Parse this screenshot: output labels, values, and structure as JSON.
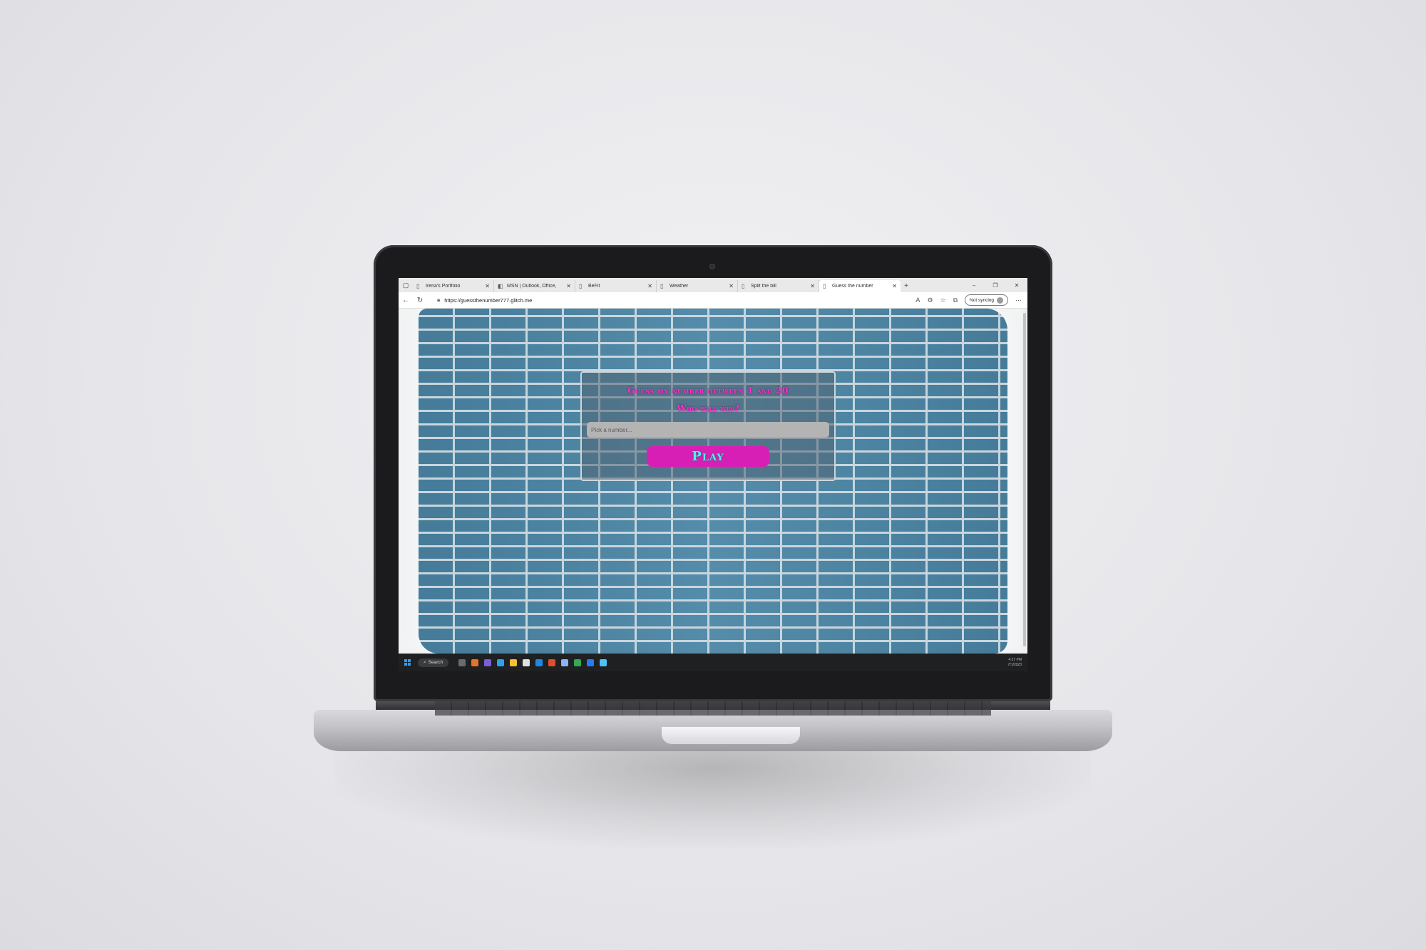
{
  "browser": {
    "tabs": [
      {
        "title": "Irena's Portfolio",
        "icon": "page-icon",
        "active": false
      },
      {
        "title": "MSN | Outlook, Office,",
        "icon": "msn-icon",
        "active": false
      },
      {
        "title": "BeFit",
        "icon": "page-icon",
        "active": false
      },
      {
        "title": "Weather",
        "icon": "page-icon",
        "active": false
      },
      {
        "title": "Split the bill",
        "icon": "page-icon",
        "active": false
      },
      {
        "title": "Guess the number",
        "icon": "page-icon",
        "active": true
      }
    ],
    "new_tab_label": "+",
    "url": "https://guessthenumber777.glitch.me",
    "sync_label": "Not syncing",
    "window_controls": {
      "minimize": "–",
      "restore": "❐",
      "close": "✕"
    }
  },
  "game": {
    "headline": "Guess my number between 1 and 20",
    "subline": "Who will win?",
    "input_placeholder": "Pick a number...",
    "play_label": "Play",
    "colors": {
      "headline": "#ff2fd0",
      "button_bg": "#d81fb5",
      "button_text": "#4ff0ee",
      "wall": "#4b86a6"
    }
  },
  "taskbar": {
    "search_label": "Search",
    "clock_time": "4:27 PM",
    "clock_date": "7/1/2023"
  }
}
